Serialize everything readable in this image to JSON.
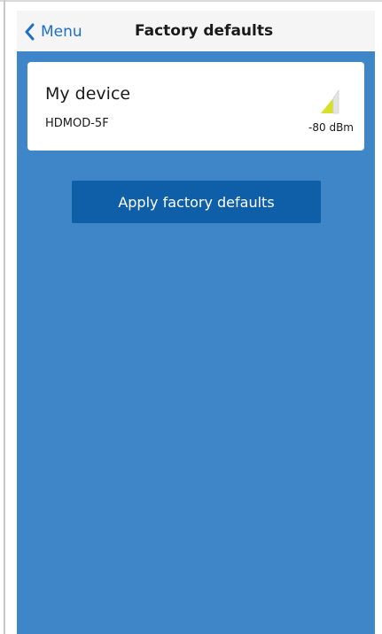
{
  "navbar": {
    "back_label": "Menu",
    "title": "Factory defaults"
  },
  "device": {
    "name": "My device",
    "model": "HDMOD-5F",
    "signal": "-80 dBm",
    "signal_level": 0.4
  },
  "actions": {
    "apply_label": "Apply factory defaults"
  },
  "colors": {
    "background": "#3f86c9",
    "navbar": "#f5f5f5",
    "accent": "#1f6fc4",
    "button": "#0f5ea8",
    "signal_active": "#d6df2a",
    "signal_inactive": "#e4e4e4"
  }
}
